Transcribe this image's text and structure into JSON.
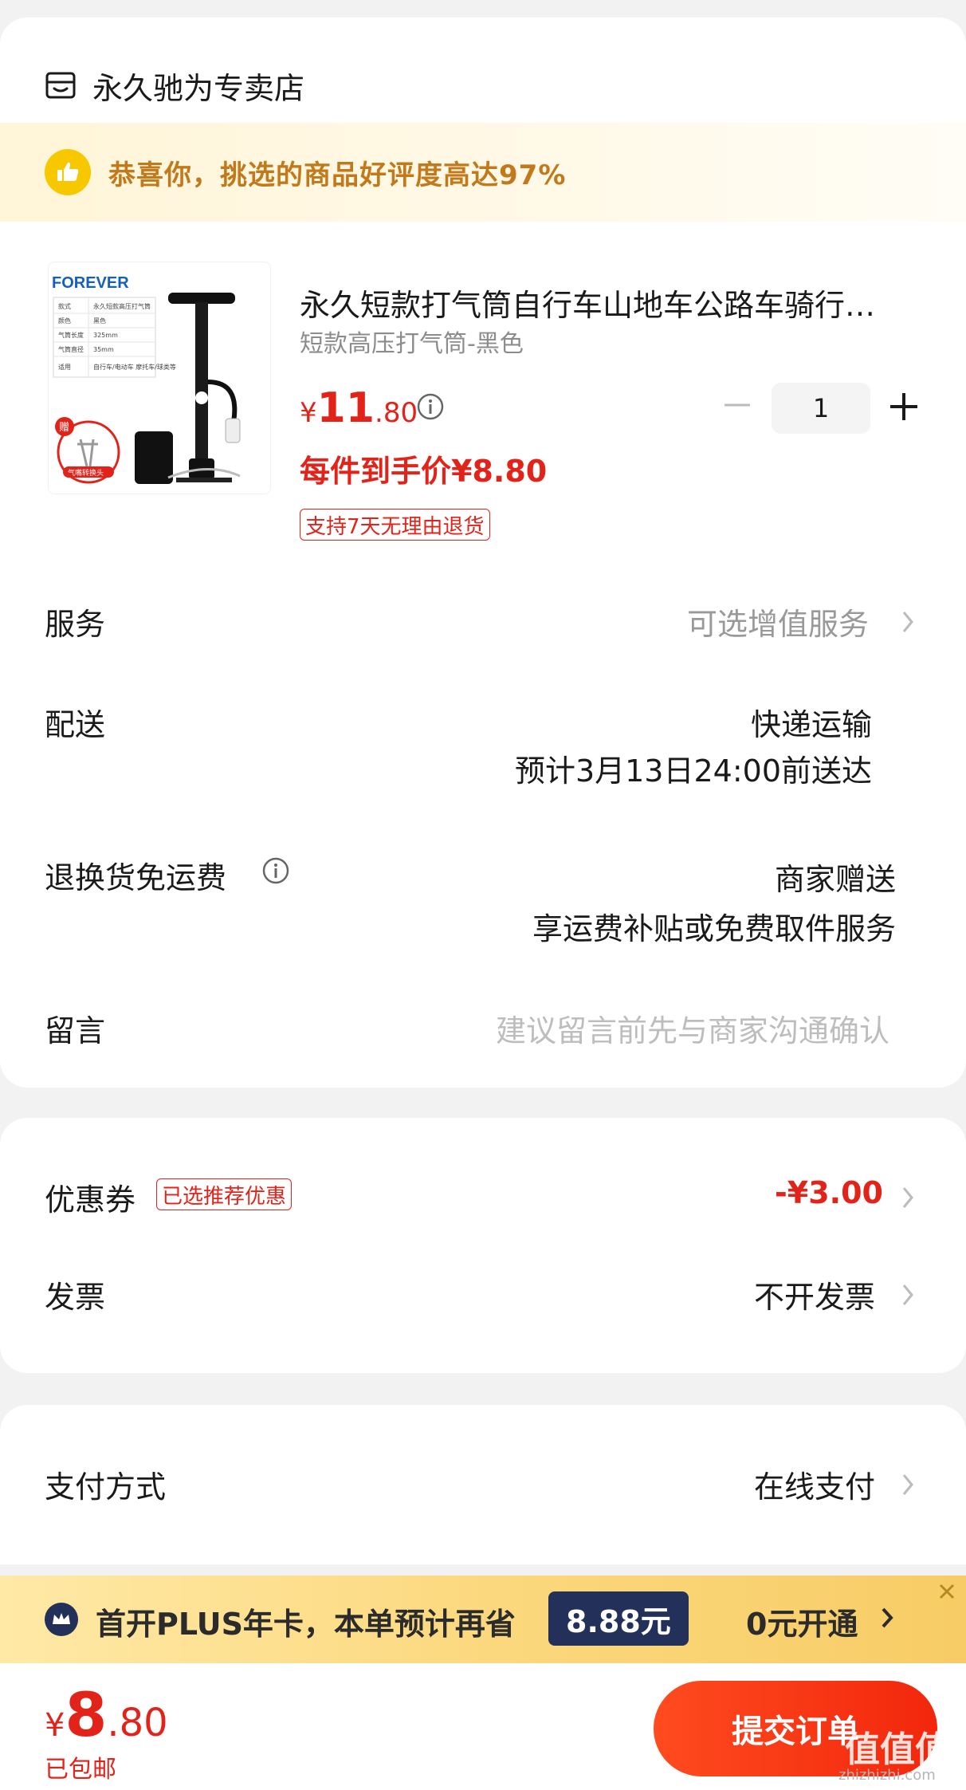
{
  "shop": {
    "name": "永久驰为专卖店",
    "icon": "store-icon"
  },
  "rating": {
    "text": "恭喜你，挑选的商品好评度高达97%",
    "icon": "thumbs-up-icon"
  },
  "product": {
    "image_brand": "FOREVER",
    "image_specs": [
      [
        "款式",
        "永久短款高压打气筒"
      ],
      [
        "颜色",
        "黑色"
      ],
      [
        "气筒长度",
        "325mm"
      ],
      [
        "气筒直径",
        "35mm"
      ],
      [
        "适用",
        "自行车/电动车 摩托车/球类等"
      ]
    ],
    "image_gift_badge": "赠",
    "image_gift_text": "气嘴转换头",
    "title": "永久短款打气筒自行车山地车公路车骑行…",
    "spec": "短款高压打气筒-黑色",
    "price_symbol": "¥",
    "price_int": "11",
    "price_dec": ".80",
    "net_price": "每件到手价¥8.80",
    "return_tag": "支持7天无理由退货",
    "quantity": "1"
  },
  "service": {
    "label": "服务",
    "value": "可选增值服务"
  },
  "delivery": {
    "label": "配送",
    "method": "快递运输",
    "eta": "预计3月13日24:00前送达"
  },
  "return_shipping": {
    "label": "退换货免运费",
    "value1": "商家赠送",
    "value2": "享运费补贴或免费取件服务"
  },
  "message": {
    "label": "留言",
    "placeholder": "建议留言前先与商家沟通确认"
  },
  "coupon": {
    "label": "优惠券",
    "tag": "已选推荐优惠",
    "value": "-¥3.00"
  },
  "invoice": {
    "label": "发票",
    "value": "不开发票"
  },
  "payment": {
    "label": "支付方式",
    "value": "在线支付"
  },
  "plus": {
    "text": "首开PLUS年卡，本单预计再省",
    "save": "8.88元",
    "action": "0元开通"
  },
  "footer": {
    "total_symbol": "¥",
    "total_int": "8",
    "total_dec": ".80",
    "shipping": "已包邮",
    "submit": "提交订单",
    "watermark": "值值值",
    "watermark_sub": "zhizhizhi.com"
  },
  "colors": {
    "accent": "#e2231a",
    "plus_navy": "#23315a",
    "rating_text": "#c2791b"
  }
}
